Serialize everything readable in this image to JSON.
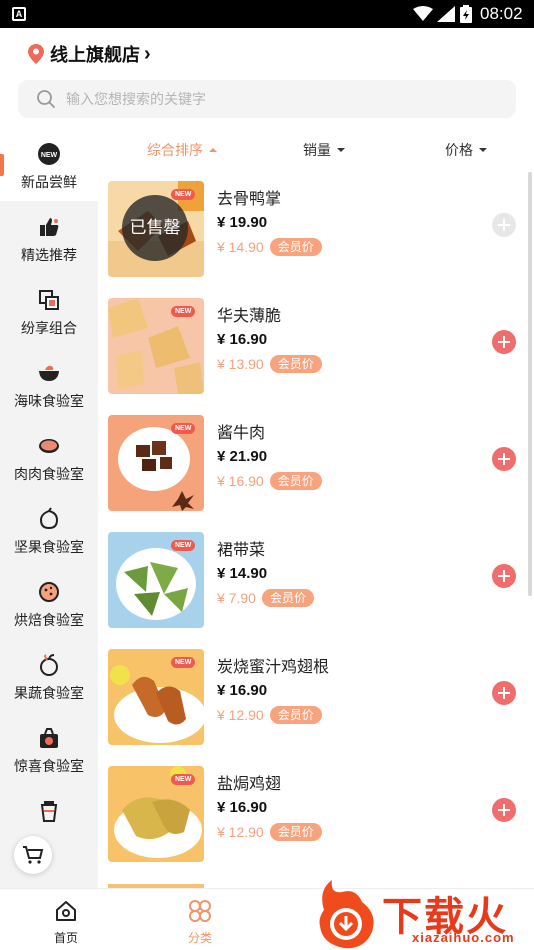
{
  "status_bar": {
    "time": "08:02"
  },
  "header": {
    "store_name": "线上旗舰店",
    "chevron": "›"
  },
  "search": {
    "placeholder": "输入您想搜索的关键字"
  },
  "sidebar": {
    "items": [
      {
        "label": "新品尝鲜",
        "icon": "new-badge-icon",
        "active": true
      },
      {
        "label": "精选推荐",
        "icon": "thumbs-up-icon"
      },
      {
        "label": "纷享组合",
        "icon": "combo-icon"
      },
      {
        "label": "海味食验室",
        "icon": "bowl-icon"
      },
      {
        "label": "肉肉食验室",
        "icon": "meat-icon"
      },
      {
        "label": "坚果食验室",
        "icon": "nut-icon"
      },
      {
        "label": "烘焙食验室",
        "icon": "cookie-icon"
      },
      {
        "label": "果蔬食验室",
        "icon": "fruit-icon"
      },
      {
        "label": "惊喜食验室",
        "icon": "gift-icon"
      },
      {
        "label": "",
        "icon": "cup-icon"
      }
    ]
  },
  "sort": {
    "tabs": [
      {
        "label": "综合排序",
        "active": true
      },
      {
        "label": "销量"
      },
      {
        "label": "价格"
      }
    ]
  },
  "products": [
    {
      "name": "去骨鸭掌",
      "price": "¥ 19.90",
      "member_price": "¥ 14.90",
      "member_tag": "会员价",
      "badge": "NEW",
      "sold_out": "已售罄"
    },
    {
      "name": "华夫薄脆",
      "price": "¥ 16.90",
      "member_price": "¥ 13.90",
      "member_tag": "会员价",
      "badge": "NEW"
    },
    {
      "name": "酱牛肉",
      "price": "¥ 21.90",
      "member_price": "¥ 16.90",
      "member_tag": "会员价",
      "badge": "NEW"
    },
    {
      "name": "裙带菜",
      "price": "¥ 14.90",
      "member_price": "¥ 7.90",
      "member_tag": "会员价",
      "badge": "NEW"
    },
    {
      "name": "炭烧蜜汁鸡翅根",
      "price": "¥ 16.90",
      "member_price": "¥ 12.90",
      "member_tag": "会员价",
      "badge": "NEW"
    },
    {
      "name": "盐焗鸡翅",
      "price": "¥ 16.90",
      "member_price": "¥ 12.90",
      "member_tag": "会员价",
      "badge": "NEW"
    }
  ],
  "bottom_nav": {
    "items": [
      {
        "label": "首页",
        "icon": "home-icon"
      },
      {
        "label": "分类",
        "icon": "category-icon",
        "active": true
      }
    ]
  },
  "watermark": {
    "brand": "下载火",
    "domain": "xiazaihuo.com"
  },
  "colors": {
    "accent": "#f0946a",
    "add_button": "#ef6d6d",
    "member_tag": "#f7a47e",
    "new_badge": "#ef5a4e"
  }
}
